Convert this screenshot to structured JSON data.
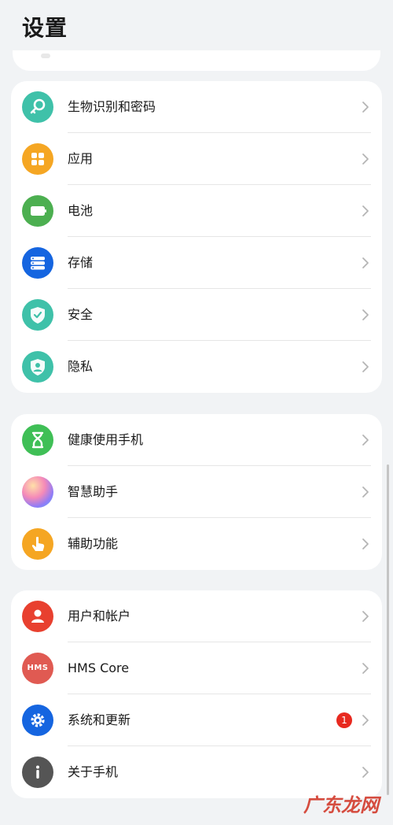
{
  "header": {
    "title": "设置"
  },
  "groups": [
    {
      "items": [
        {
          "label": "生物识别和密码",
          "color": "#3fc1a9",
          "icon": "key-icon"
        },
        {
          "label": "应用",
          "color": "#f5a623",
          "icon": "apps-grid-icon"
        },
        {
          "label": "电池",
          "color": "#4caf50",
          "icon": "battery-icon"
        },
        {
          "label": "存储",
          "color": "#1565e0",
          "icon": "storage-icon"
        },
        {
          "label": "安全",
          "color": "#3fc1a9",
          "icon": "shield-check-icon"
        },
        {
          "label": "隐私",
          "color": "#3fc1a9",
          "icon": "privacy-shield-icon"
        }
      ]
    },
    {
      "items": [
        {
          "label": "健康使用手机",
          "color": "#3fbf56",
          "icon": "hourglass-icon"
        },
        {
          "label": "智慧助手",
          "color": "#b07cf0",
          "icon": "smart-assistant-icon"
        },
        {
          "label": "辅助功能",
          "color": "#f5a623",
          "icon": "hand-pointer-icon"
        }
      ]
    },
    {
      "items": [
        {
          "label": "用户和帐户",
          "color": "#e8402f",
          "icon": "user-icon"
        },
        {
          "label": "HMS Core",
          "color": "#e05a52",
          "icon": "hms-core-icon",
          "icon_text": "HMS"
        },
        {
          "label": "系统和更新",
          "color": "#1565e0",
          "icon": "gear-icon",
          "badge": "1"
        },
        {
          "label": "关于手机",
          "color": "#555555",
          "icon": "info-icon"
        }
      ]
    }
  ],
  "watermark": "广东龙网"
}
